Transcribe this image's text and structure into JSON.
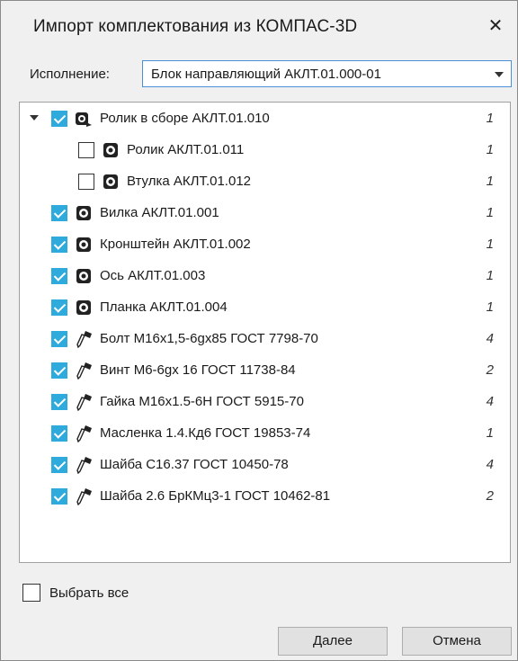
{
  "dialog": {
    "title": "Импорт комплектования из КОМПАС-3D",
    "close_glyph": "✕"
  },
  "variant": {
    "label": "Исполнение:",
    "value": "Блок направляющий АКЛТ.01.000-01"
  },
  "tree": {
    "items": [
      {
        "label": "Ролик в сборе АКЛТ.01.010",
        "qty": "1",
        "checked": true,
        "icon": "assembly-icon",
        "level": 0,
        "expandable": true
      },
      {
        "label": "Ролик АКЛТ.01.011",
        "qty": "1",
        "checked": false,
        "icon": "part-icon",
        "level": 1,
        "expandable": false
      },
      {
        "label": "Втулка АКЛТ.01.012",
        "qty": "1",
        "checked": false,
        "icon": "part-icon",
        "level": 1,
        "expandable": false
      },
      {
        "label": "Вилка АКЛТ.01.001",
        "qty": "1",
        "checked": true,
        "icon": "part-icon",
        "level": 0,
        "expandable": false
      },
      {
        "label": "Кронштейн АКЛТ.01.002",
        "qty": "1",
        "checked": true,
        "icon": "part-icon",
        "level": 0,
        "expandable": false
      },
      {
        "label": "Ось АКЛТ.01.003",
        "qty": "1",
        "checked": true,
        "icon": "part-icon",
        "level": 0,
        "expandable": false
      },
      {
        "label": "Планка АКЛТ.01.004",
        "qty": "1",
        "checked": true,
        "icon": "part-icon",
        "level": 0,
        "expandable": false
      },
      {
        "label": "Болт М16х1,5-6gх85 ГОСТ 7798-70",
        "qty": "4",
        "checked": true,
        "icon": "standard-item-icon",
        "level": 0,
        "expandable": false
      },
      {
        "label": "Винт М6-6gх 16 ГОСТ 11738-84",
        "qty": "2",
        "checked": true,
        "icon": "standard-item-icon",
        "level": 0,
        "expandable": false
      },
      {
        "label": "Гайка М16х1.5-6Н ГОСТ 5915-70",
        "qty": "4",
        "checked": true,
        "icon": "standard-item-icon",
        "level": 0,
        "expandable": false
      },
      {
        "label": "Масленка 1.4.Кд6 ГОСТ 19853-74",
        "qty": "1",
        "checked": true,
        "icon": "standard-item-icon",
        "level": 0,
        "expandable": false
      },
      {
        "label": "Шайба С16.37 ГОСТ 10450-78",
        "qty": "4",
        "checked": true,
        "icon": "standard-item-icon",
        "level": 0,
        "expandable": false
      },
      {
        "label": "Шайба 2.6 БрКМц3-1 ГОСТ 10462-81",
        "qty": "2",
        "checked": true,
        "icon": "standard-item-icon",
        "level": 0,
        "expandable": false
      }
    ]
  },
  "select_all": {
    "label": "Выбрать все",
    "checked": false
  },
  "buttons": {
    "next_label": "Далее",
    "cancel_label": "Отмена"
  },
  "colors": {
    "checkbox_checked": "#2eaadc",
    "select_focus": "#4a90d9"
  }
}
